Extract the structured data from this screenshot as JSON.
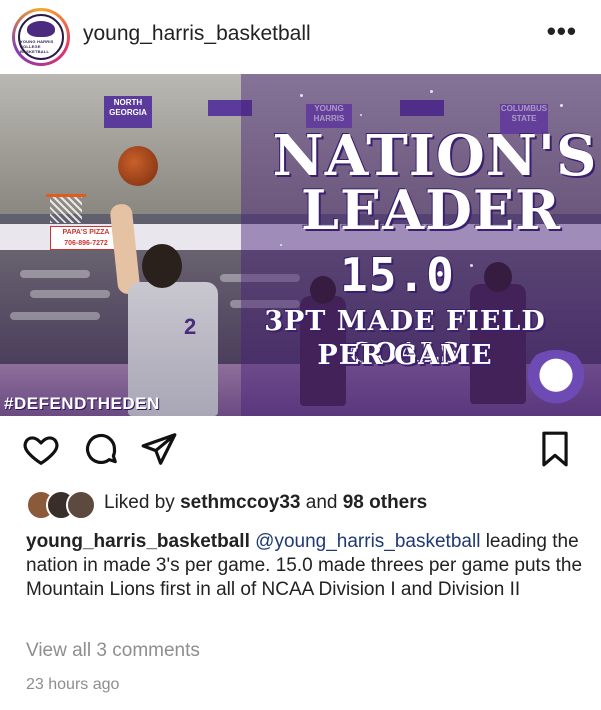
{
  "header": {
    "username": "young_harris_basketball",
    "avatar_text": "YOUNG HARRIS COLLEGE BASKETBALL",
    "more_icon": "more-horizontal-icon",
    "more_label": "•••"
  },
  "post_image": {
    "headline_line1": "NATION'S",
    "headline_line2": "LEADER",
    "stat_value": "15.0",
    "stat_label_line1": "3PT MADE FIELD GOALS",
    "stat_label_line2": "PER GAME",
    "hashtag": "#DEFENDTHEDEN",
    "banner_left": "NORTH GEORGIA",
    "banner_mid": "YOUNG HARRIS",
    "banner_right": "COLUMBUS STATE",
    "pizza_sign": "PAPA'S PIZZA",
    "pizza_phone": "706-896-7272",
    "jersey_number": "2",
    "accent_color": "#5a3a9a"
  },
  "actions": {
    "like_icon": "heart-icon",
    "comment_icon": "comment-icon",
    "share_icon": "send-icon",
    "save_icon": "bookmark-icon"
  },
  "likes": {
    "prefix": "Liked by",
    "user": "sethmccoy33",
    "middle": "and",
    "others": "98 others"
  },
  "caption": {
    "username": "young_harris_basketball",
    "mention": "@young_harris_basketball",
    "text": "leading the nation in made 3's per game. 15.0 made threes per game puts the Mountain Lions first in all of NCAA Division I and Division II"
  },
  "comments_link": "View all 3 comments",
  "timestamp": "23 hours ago"
}
